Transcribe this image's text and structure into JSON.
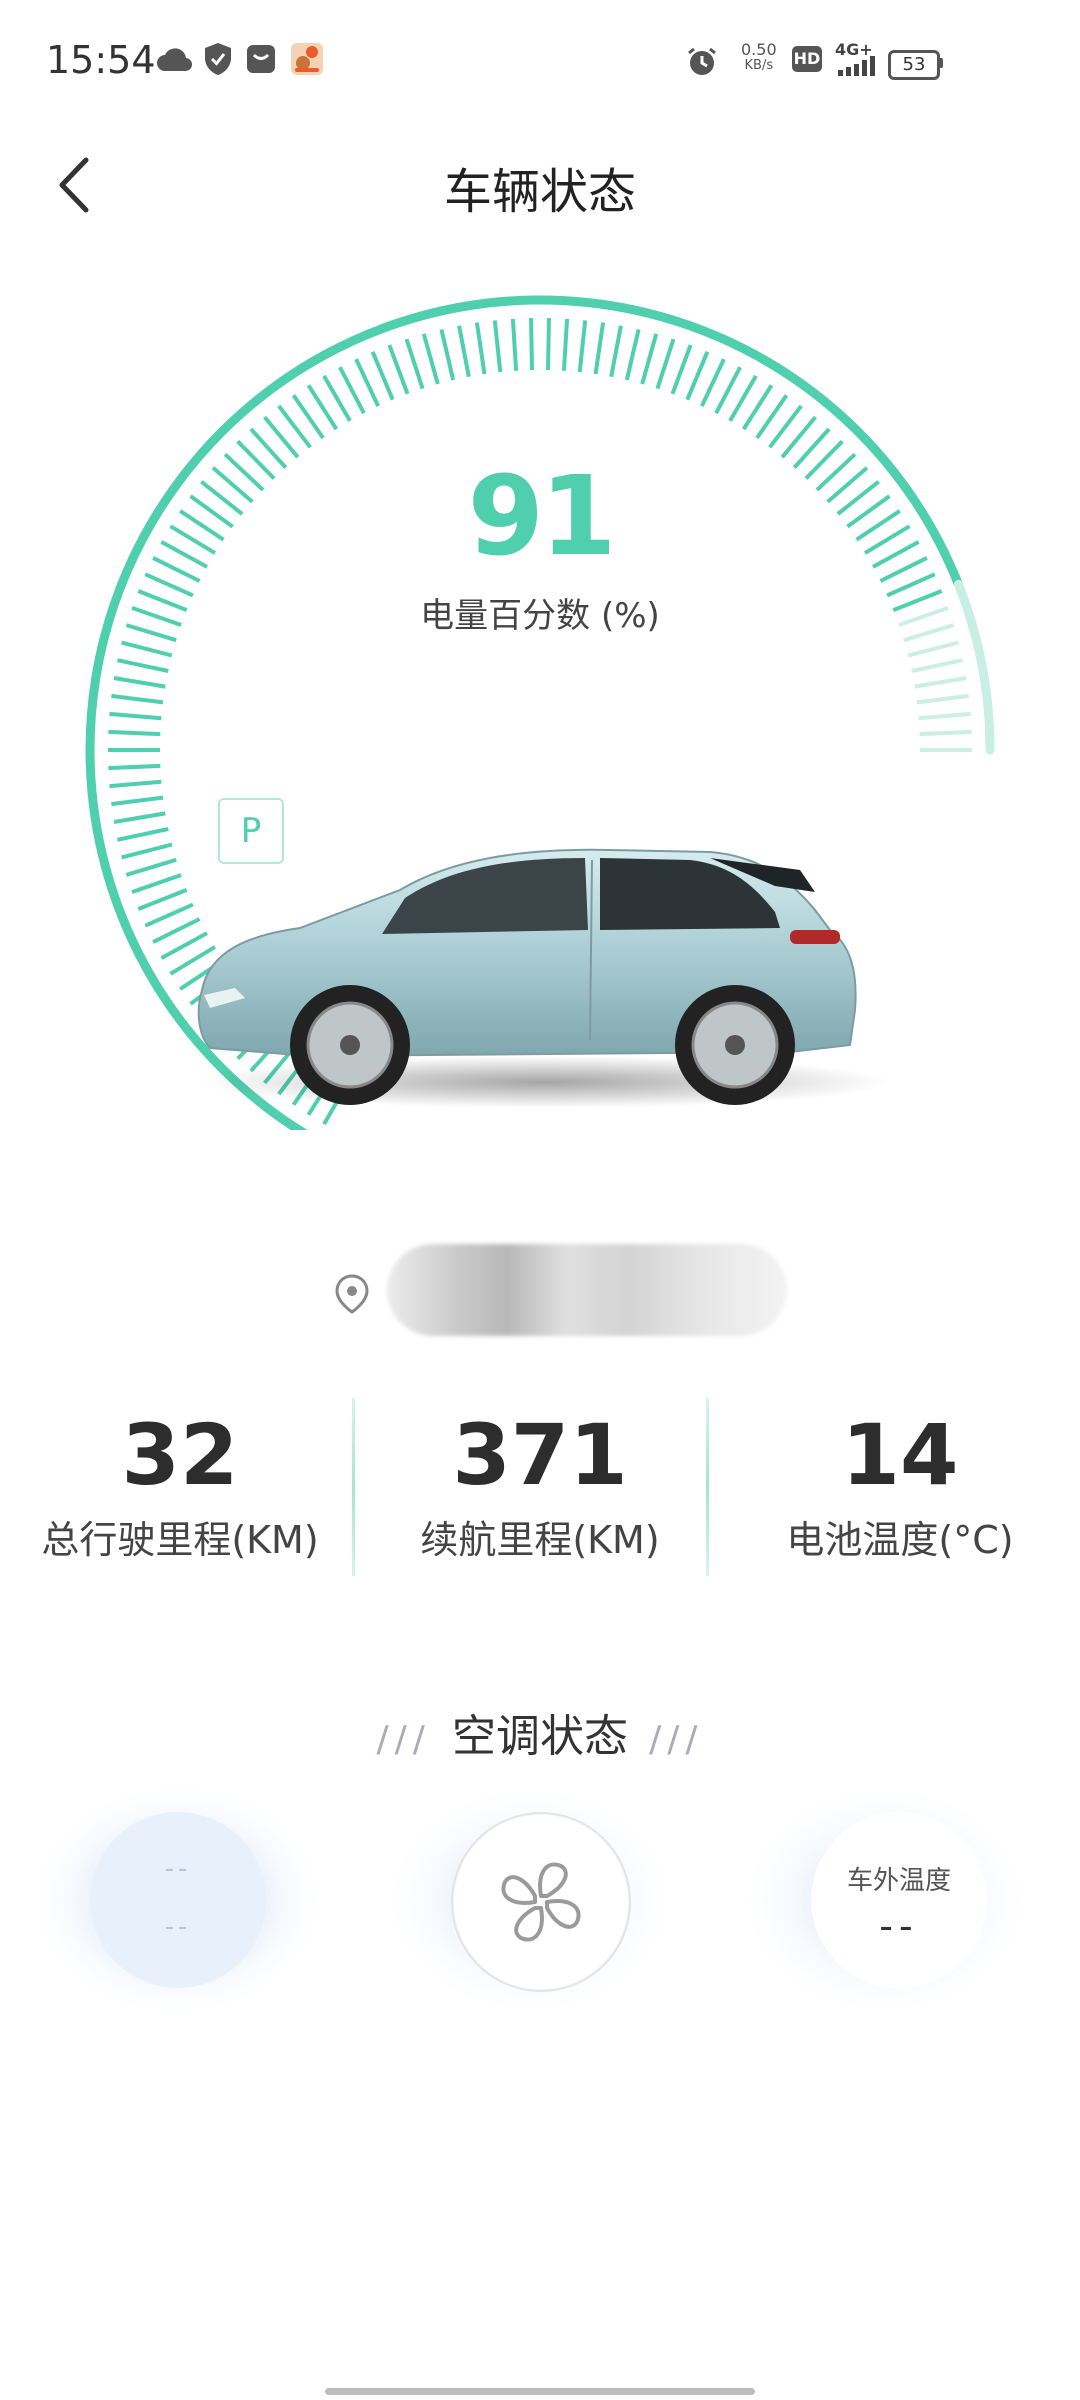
{
  "status_bar": {
    "time": "15:54",
    "net_speed_value": "0.50",
    "net_speed_unit": "KB/s",
    "hd_label": "HD",
    "signal_label": "4G+",
    "battery_level": "53",
    "left_icons": [
      "cloud-icon",
      "shield-icon",
      "mail-icon",
      "app-notification-icon"
    ],
    "right_icons": [
      "alarm-icon",
      "signal-icon",
      "battery-icon"
    ]
  },
  "header": {
    "title": "车辆状态"
  },
  "gauge": {
    "value": "91",
    "label": "电量百分数 (%)",
    "fill_fraction": 0.91,
    "park_label": "P",
    "accent_color": "#4fcfae"
  },
  "stats": [
    {
      "value": "32",
      "label": "总行驶里程(KM)"
    },
    {
      "value": "371",
      "label": "续航里程(KM)"
    },
    {
      "value": "14",
      "label": "电池温度(°C)"
    }
  ],
  "ac": {
    "title": "空调状态",
    "deco_left": "///",
    "deco_right": "///",
    "cabin_temp_top": "--",
    "cabin_temp_bottom": "--",
    "outside_label": "车外温度",
    "outside_value": "--"
  }
}
